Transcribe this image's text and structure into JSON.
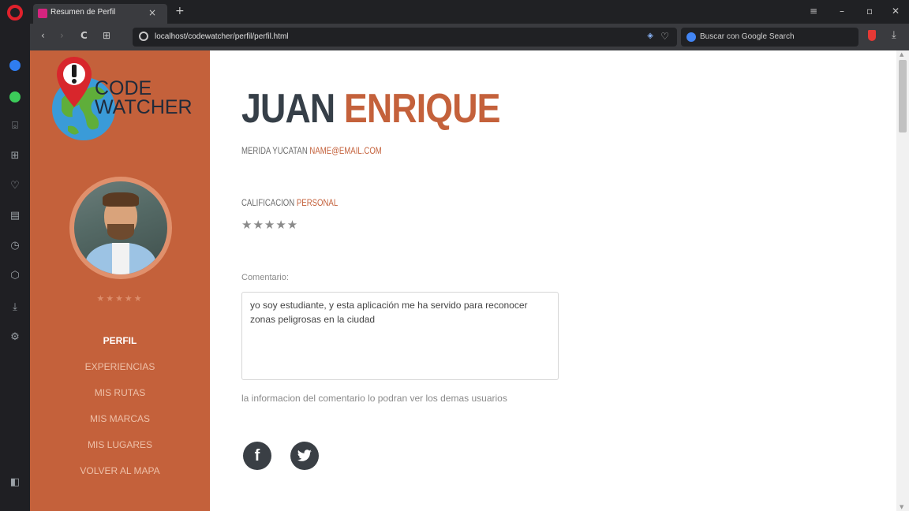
{
  "browser": {
    "tab_title": "Resumen de Perfil",
    "tab_close": "×",
    "new_tab": "+",
    "window_controls": {
      "minimize": "–",
      "maximize": "▫",
      "close": "✕"
    },
    "url": "localhost/codewatcher/perfil/perfil.html",
    "search_placeholder": "Buscar con Google Search",
    "nav_back": "‹",
    "nav_forward": "›",
    "reload": "C",
    "speed_dial": "⊞",
    "icons": [
      "opera-logo",
      "messenger-icon",
      "whatsapp-icon",
      "camera-icon",
      "speed-dial-icon",
      "heart-icon",
      "news-icon",
      "history-icon",
      "box-icon",
      "download-icon",
      "settings-icon",
      "sidebar-toggle-icon"
    ]
  },
  "logo": {
    "line1": "CODE",
    "line2": "WATCHER"
  },
  "sidebar": {
    "stars": "★★★★★",
    "nav": [
      {
        "label": "PERFIL",
        "active": true
      },
      {
        "label": "EXPERIENCIAS",
        "active": false
      },
      {
        "label": "MIS RUTAS",
        "active": false
      },
      {
        "label": "MIS MARCAS",
        "active": false
      },
      {
        "label": "MIS LUGARES",
        "active": false
      },
      {
        "label": "VOLVER AL MAPA",
        "active": false
      }
    ]
  },
  "profile": {
    "first_name": "JUAN",
    "last_name": "ENRIQUE",
    "location": "MERIDA YUCATAN",
    "email": "NAME@EMAIL.COM",
    "rating_label_1": "CALIFICACION",
    "rating_label_2": "PERSONAL",
    "rating_stars": "★★★★★",
    "rating_value": 5,
    "comment_label": "Comentario:",
    "comment_text": "yo soy estudiante, y esta aplicación me ha servido para reconocer zonas peligrosas en la ciudad",
    "comment_help": "la informacion del comentario lo podran ver los demas usuarios"
  },
  "social": {
    "facebook": "f",
    "twitter": "🐦"
  },
  "colors": {
    "accent": "#c4613b",
    "dark_text": "#363f48",
    "sidebar_text": "#eec0a8",
    "social_bg": "#3a3f45"
  }
}
